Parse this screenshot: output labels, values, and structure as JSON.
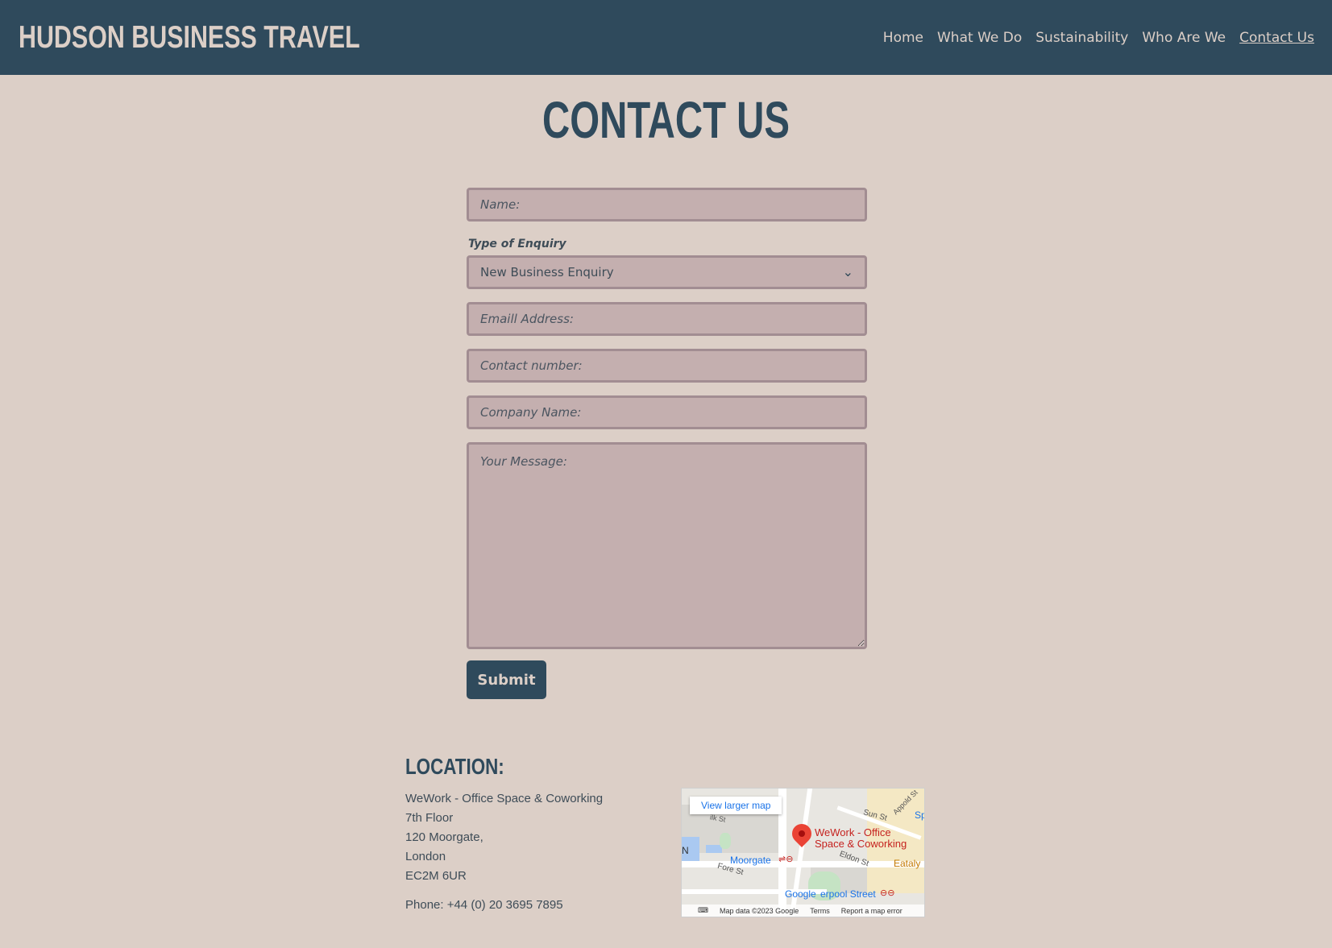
{
  "header": {
    "brand": "HUDSON BUSINESS TRAVEL",
    "nav": [
      "Home",
      "What We Do",
      "Sustainability",
      "Who Are We",
      "Contact Us"
    ],
    "active_nav": "Contact Us"
  },
  "page_title": "CONTACT US",
  "form": {
    "name_placeholder": "Name:",
    "enquiry_label": "Type of Enquiry",
    "enquiry_selected": "New Business Enquiry",
    "email_placeholder": "Emaill Address:",
    "phone_placeholder": "Contact number:",
    "company_placeholder": "Company Name:",
    "message_placeholder": "Your Message:",
    "submit_label": "Submit"
  },
  "location": {
    "heading": "LOCATION:",
    "address_lines": [
      "WeWork - Office Space & Coworking",
      "7th Floor",
      "120 Moorgate,",
      "London",
      "EC2M 6UR"
    ],
    "phone": "Phone: +44 (0) 20 3695 7895"
  },
  "map": {
    "view_larger": "View larger map",
    "place_label_1": "WeWork - Office",
    "place_label_2": "Space & Coworking",
    "station_moorgate": "Moorgate",
    "station_liverpool": "erpool Street",
    "street_eldon": "Eldon St",
    "street_fore": "Fore St",
    "street_sun": "Sun St",
    "street_appold": "Appold St",
    "street_silk": "ilk St",
    "poi_eataly": "Eataly",
    "poi_sp": "Sp",
    "edge_n": "N",
    "google": "Google",
    "map_data": "Map data ©2023 Google",
    "terms": "Terms",
    "report": "Report a map error",
    "icon_pin": "map-pin-icon",
    "icon_keyboard": "keyboard-icon"
  },
  "colors": {
    "background": "#dccfc7",
    "header_bg": "#2f4a5c",
    "field_bg": "#c4afaf",
    "field_border": "#a28d92",
    "accent_text": "#2f4a5c"
  }
}
